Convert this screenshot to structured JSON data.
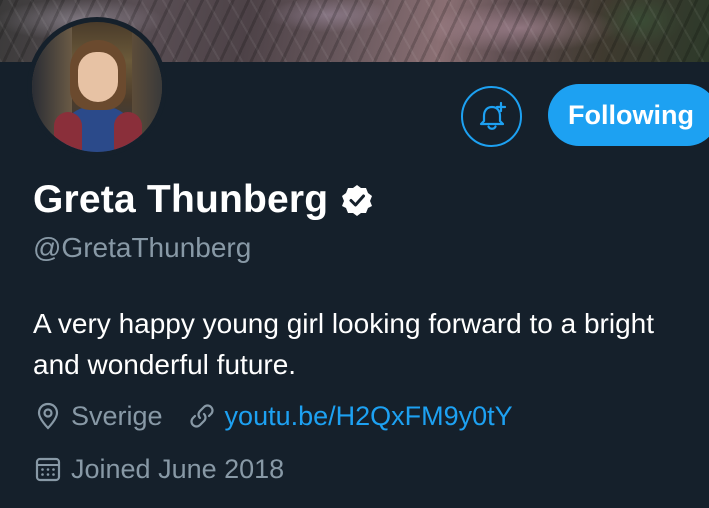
{
  "profile": {
    "name": "Greta Thunberg",
    "handle": "@GretaThunberg",
    "bio": "A very happy young girl looking forward to a bright and wonderful future.",
    "location": "Sverige",
    "website": "youtu.be/H2QxFM9y0tY",
    "joined": "Joined June 2018",
    "verified": true
  },
  "actions": {
    "follow_label": "Following",
    "notifications_icon": "bell-plus-icon"
  },
  "icons": {
    "verified": "verified-badge-icon",
    "location": "location-pin-icon",
    "link": "link-icon",
    "calendar": "calendar-icon"
  },
  "colors": {
    "background": "#15202b",
    "accent": "#1da1f2",
    "secondary_text": "#8899a6",
    "primary_text": "#ffffff"
  }
}
